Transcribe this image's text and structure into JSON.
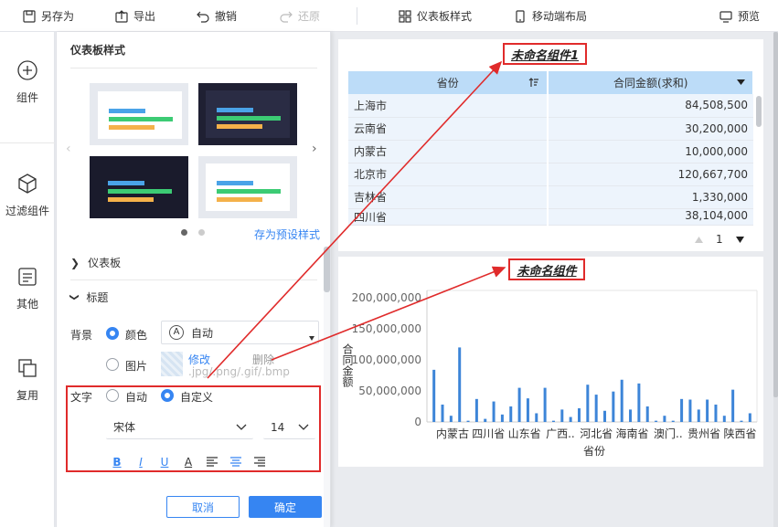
{
  "toolbar": {
    "save_as": "另存为",
    "export": "导出",
    "undo": "撤销",
    "redo": "还原",
    "dashboard_style": "仪表板样式",
    "mobile_layout": "移动端布局",
    "preview": "预览"
  },
  "rail": {
    "items": [
      {
        "label": "组件",
        "icon": "plus-circle-icon"
      },
      {
        "label": "过滤组件",
        "icon": "cube-icon"
      },
      {
        "label": "其他",
        "icon": "text-box-icon"
      },
      {
        "label": "复用",
        "icon": "stack-icon"
      }
    ]
  },
  "panel": {
    "title": "仪表板样式",
    "preset_link": "存为预设样式",
    "section_dashboard": "仪表板",
    "section_title": "标题",
    "background_label": "背景",
    "bg_color_option": "颜色",
    "bg_auto": "自动",
    "bg_image_option": "图片",
    "bg_modify": "修改",
    "bg_delete": "删除",
    "bg_hint": ".jpg/.png/.gif/.bmp",
    "text_label": "文字",
    "text_auto": "自动",
    "text_custom": "自定义",
    "font_family": "宋体",
    "font_size": "14",
    "format_buttons": [
      "B",
      "I",
      "U",
      "A"
    ],
    "cancel": "取消",
    "confirm": "确定",
    "theme_colors": {
      "light_bg": "#e6e9ef",
      "dark_bg": "#1f2033",
      "blue": "#4aa3e8",
      "green": "#3ccb74",
      "orange": "#f4b14a"
    }
  },
  "table_widget": {
    "title": "未命名组件1",
    "columns": [
      "省份",
      "合同金额(求和)"
    ],
    "rows": [
      [
        "上海市",
        "84,508,500"
      ],
      [
        "云南省",
        "30,200,000"
      ],
      [
        "内蒙古",
        "10,000,000"
      ],
      [
        "北京市",
        "120,667,700"
      ],
      [
        "吉林省",
        "1,330,000"
      ],
      [
        "四川省",
        "38,104,000"
      ]
    ],
    "page": "1"
  },
  "chart_widget": {
    "title": "未命名组件"
  },
  "chart_data": {
    "type": "bar",
    "title": "未命名组件",
    "xlabel": "省份",
    "ylabel": "合同金额",
    "ylim": [
      0,
      200000000
    ],
    "yticks": [
      "200,000,000",
      "150,000,000",
      "100,000,000",
      "50,000,000",
      "0"
    ],
    "x_tick_labels": [
      "内蒙古",
      "四川省",
      "山东省",
      "广西..",
      "河北省",
      "海南省",
      "澳门..",
      "贵州省",
      "陕西省"
    ],
    "values": [
      84000000,
      28000000,
      10000000,
      120000000,
      2000000,
      37000000,
      5000000,
      33000000,
      12000000,
      25000000,
      55000000,
      38000000,
      14000000,
      55000000,
      2000000,
      20000000,
      8000000,
      22000000,
      60000000,
      44000000,
      18000000,
      49000000,
      68000000,
      20000000,
      62000000,
      25000000,
      2000000,
      10000000,
      2000000,
      37000000,
      36000000,
      20000000,
      36000000,
      28000000,
      10000000,
      52000000,
      2000000,
      14000000
    ],
    "bar_color": "#3d85d8"
  }
}
